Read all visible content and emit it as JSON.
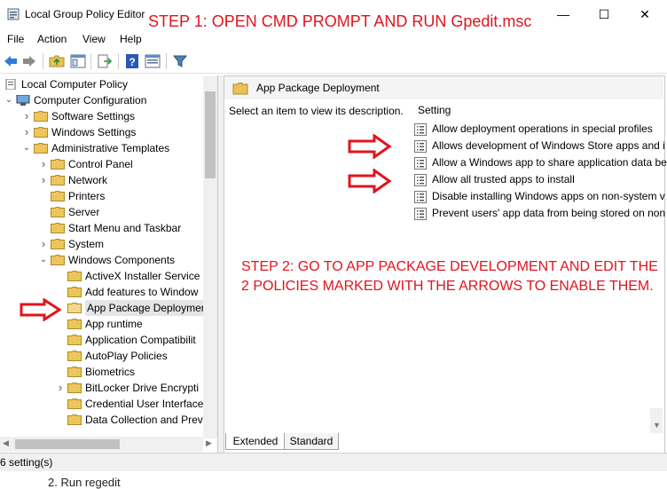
{
  "window": {
    "title": "Local Group Policy Editor",
    "minimize": "—",
    "maximize": "☐",
    "close": "✕"
  },
  "annotations": {
    "step1": "STEP 1: OPEN CMD PROMPT AND RUN Gpedit.msc",
    "step2": "STEP 2: GO TO APP PACKAGE DEVELOPMENT AND EDIT THE 2 POLICIES MARKED WITH THE ARROWS TO ENABLE THEM.",
    "color": "#e0141e"
  },
  "menu": [
    "File",
    "Action",
    "View",
    "Help"
  ],
  "toolbar_icons": [
    "back-icon",
    "forward-icon",
    "up-folder-icon",
    "show-hide-tree-icon",
    "export-list-icon",
    "help-icon",
    "properties-icon",
    "filter-icon"
  ],
  "tree": {
    "root": "Local Computer Policy",
    "items": [
      {
        "label": "Computer Configuration",
        "level": 1,
        "expander": "open",
        "icon": "computer-icon"
      },
      {
        "label": "Software Settings",
        "level": 2,
        "expander": "closed",
        "icon": "folder-icon"
      },
      {
        "label": "Windows Settings",
        "level": 2,
        "expander": "closed",
        "icon": "folder-icon"
      },
      {
        "label": "Administrative Templates",
        "level": 2,
        "expander": "open",
        "icon": "folder-icon"
      },
      {
        "label": "Control Panel",
        "level": 3,
        "expander": "closed",
        "icon": "folder-icon"
      },
      {
        "label": "Network",
        "level": 3,
        "expander": "closed",
        "icon": "folder-icon"
      },
      {
        "label": "Printers",
        "level": 3,
        "expander": "none",
        "icon": "folder-icon"
      },
      {
        "label": "Server",
        "level": 3,
        "expander": "none",
        "icon": "folder-icon"
      },
      {
        "label": "Start Menu and Taskbar",
        "level": 3,
        "expander": "none",
        "icon": "folder-icon"
      },
      {
        "label": "System",
        "level": 3,
        "expander": "closed",
        "icon": "folder-icon"
      },
      {
        "label": "Windows Components",
        "level": 3,
        "expander": "open",
        "icon": "folder-icon"
      },
      {
        "label": "ActiveX Installer Service",
        "level": 4,
        "expander": "none",
        "icon": "folder-icon"
      },
      {
        "label": "Add features to Window",
        "level": 4,
        "expander": "none",
        "icon": "folder-icon"
      },
      {
        "label": "App Package Deploymer",
        "level": 4,
        "expander": "none",
        "icon": "folder-open-icon",
        "selected": true
      },
      {
        "label": "App runtime",
        "level": 4,
        "expander": "none",
        "icon": "folder-icon"
      },
      {
        "label": "Application Compatibilit",
        "level": 4,
        "expander": "none",
        "icon": "folder-icon"
      },
      {
        "label": "AutoPlay Policies",
        "level": 4,
        "expander": "none",
        "icon": "folder-icon"
      },
      {
        "label": "Biometrics",
        "level": 4,
        "expander": "none",
        "icon": "folder-icon"
      },
      {
        "label": "BitLocker Drive Encrypti",
        "level": 4,
        "expander": "closed",
        "icon": "folder-icon"
      },
      {
        "label": "Credential User Interface",
        "level": 4,
        "expander": "none",
        "icon": "folder-icon"
      },
      {
        "label": "Data Collection and Prev",
        "level": 4,
        "expander": "none",
        "icon": "folder-icon"
      }
    ]
  },
  "right_pane": {
    "title": "App Package Deployment",
    "description": "Select an item to view its description.",
    "column_header": "Setting",
    "policies": [
      "Allow deployment operations in special profiles",
      "Allows development of Windows Store apps and i",
      "Allow a Windows app to share application data be",
      "Allow all trusted apps to install",
      "Disable installing Windows apps on non-system v",
      "Prevent users' app data from being stored on non"
    ]
  },
  "tabs": [
    "Extended",
    "Standard"
  ],
  "status": "6 setting(s)",
  "below_text": "2. Run regedit"
}
